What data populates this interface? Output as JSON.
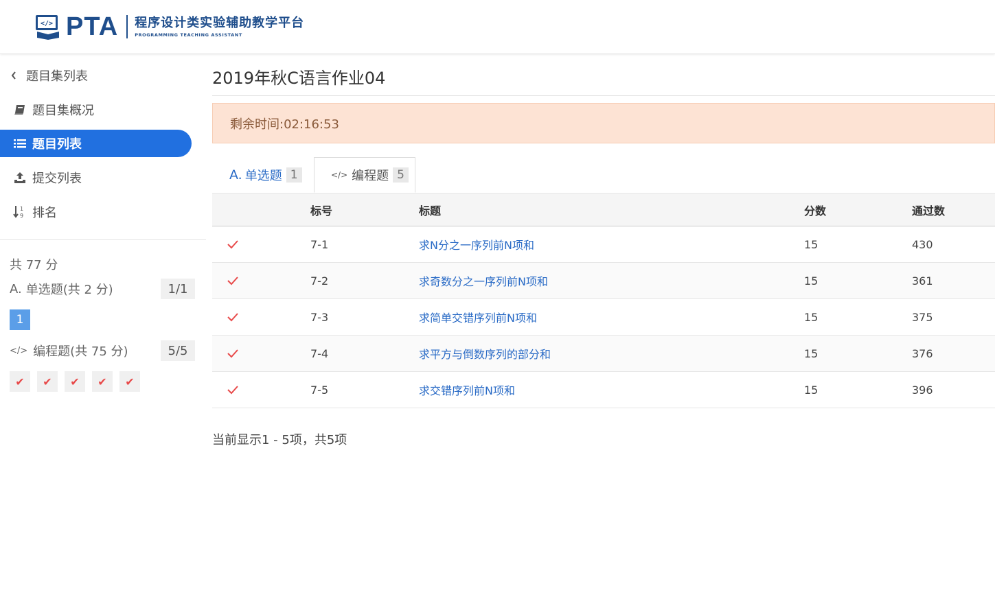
{
  "header": {
    "logo_text": "PTA",
    "platform_name": "程序设计类实验辅助教学平台",
    "platform_name_en": "PROGRAMMING TEACHING ASSISTANT"
  },
  "sidebar": {
    "items": [
      {
        "label": "题目集列表",
        "icon": "chevron-left-icon"
      },
      {
        "label": "题目集概况",
        "icon": "book-icon"
      },
      {
        "label": "题目列表",
        "icon": "list-icon",
        "active": true
      },
      {
        "label": "提交列表",
        "icon": "upload-icon"
      },
      {
        "label": "排名",
        "icon": "sort-numeric-icon"
      }
    ],
    "score_total": "共 77 分",
    "sections": [
      {
        "icon_text": "A.",
        "label": "单选题(共 2 分)",
        "count": "1/1",
        "questions": [
          "1"
        ]
      },
      {
        "icon_text": "</>",
        "label": "编程题(共 75 分)",
        "count": "5/5",
        "questions": [
          "✔",
          "✔",
          "✔",
          "✔",
          "✔"
        ]
      }
    ]
  },
  "main": {
    "title": "2019年秋C语言作业04",
    "timer": "剩余时间:02:16:53",
    "tabs": [
      {
        "icon_text": "A.",
        "label": "单选题",
        "count": "1"
      },
      {
        "icon_text": "</>",
        "label": "编程题",
        "count": "5",
        "active": true
      }
    ],
    "table": {
      "headers": [
        "标号",
        "标题",
        "分数",
        "通过数"
      ],
      "rows": [
        {
          "id": "7-1",
          "title": "求N分之一序列前N项和",
          "score": "15",
          "passed": "430"
        },
        {
          "id": "7-2",
          "title": "求奇数分之一序列前N项和",
          "score": "15",
          "passed": "361"
        },
        {
          "id": "7-3",
          "title": "求简单交错序列前N项和",
          "score": "15",
          "passed": "375"
        },
        {
          "id": "7-4",
          "title": "求平方与倒数序列的部分和",
          "score": "15",
          "passed": "376"
        },
        {
          "id": "7-5",
          "title": "求交错序列前N项和",
          "score": "15",
          "passed": "396"
        }
      ]
    },
    "footer": "当前显示1 - 5项，共5项"
  },
  "colors": {
    "brand": "#1f4e8c",
    "active_nav": "#2170e0",
    "link": "#2a6bc6",
    "check": "#e84a4a",
    "timer_bg": "#fde3d4"
  }
}
